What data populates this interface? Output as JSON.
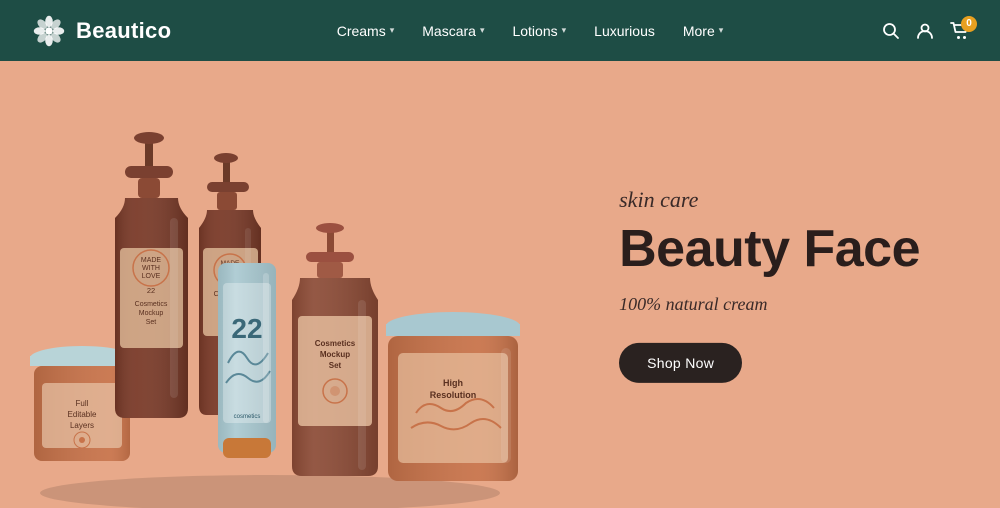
{
  "brand": {
    "name": "Beautico",
    "logo_alt": "Beautico logo"
  },
  "navbar": {
    "background_color": "#1e4d45",
    "links": [
      {
        "label": "Creams",
        "has_dropdown": true
      },
      {
        "label": "Mascara",
        "has_dropdown": true
      },
      {
        "label": "Lotions",
        "has_dropdown": true
      },
      {
        "label": "Luxurious",
        "has_dropdown": false
      },
      {
        "label": "More",
        "has_dropdown": true
      }
    ],
    "cart_count": "0"
  },
  "hero": {
    "background_color": "#e8a98a",
    "subtitle": "skin care",
    "title": "Beauty Face",
    "description": "100% natural cream",
    "cta_label": "Shop Now"
  },
  "products": {
    "labels": [
      "Full Editable Layers",
      "Cosmetics Mockup Set",
      "22",
      "Cosmetics Mockup Set",
      "High Resolution"
    ]
  }
}
